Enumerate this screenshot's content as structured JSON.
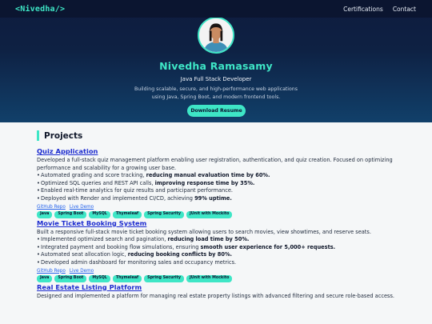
{
  "nav": {
    "brand": "<Nivedha/>",
    "links": [
      "Certifications",
      "Contact"
    ]
  },
  "hero": {
    "name": "Nivedha Ramasamy",
    "role": "Java Full Stack Developer",
    "tagline": "Building scalable, secure, and high-performance web applications using Java, Spring Boot, and modern frontend tools.",
    "button": "Download Resume"
  },
  "projects_section": {
    "title": "Projects"
  },
  "projects": [
    {
      "title": "Quiz Application",
      "description": "Developed a full-stack quiz management platform enabling user registration, authentication, and quiz creation. Focused on optimizing performance and scalability for a growing user base.",
      "bullets": [
        {
          "text": "Automated grading and score tracking, ",
          "bold": "reducing manual evaluation time by 60%."
        },
        {
          "text": "Optimized SQL queries and REST API calls, ",
          "bold": "improving response time by 35%."
        },
        {
          "text": "Enabled real-time analytics for quiz results and participant performance.",
          "bold": ""
        },
        {
          "text": "Deployed with Render and implemented CI/CD, achieving ",
          "bold": "99% uptime."
        }
      ],
      "links": [
        "GitHub Repo",
        "Live Demo"
      ],
      "tags": [
        "Java",
        "Spring Boot",
        "MySQL",
        "Thymeleaf",
        "Spring Security",
        "JUnit with Mockito"
      ]
    },
    {
      "title": "Movie Ticket Booking System",
      "description": "Built a responsive full-stack movie ticket booking system allowing users to search movies, view showtimes, and reserve seats.",
      "bullets": [
        {
          "text": "Implemented optimized search and pagination, ",
          "bold": "reducing load time by 50%."
        },
        {
          "text": "Integrated payment and booking flow simulations, ensuring ",
          "bold": "smooth user experience for 5,000+ requests."
        },
        {
          "text": "Automated seat allocation logic, ",
          "bold": "reducing booking conflicts by 80%."
        },
        {
          "text": "Developed admin dashboard for monitoring sales and occupancy metrics.",
          "bold": ""
        }
      ],
      "links": [
        "GitHub Repo",
        "Live Demo"
      ],
      "tags": [
        "Java",
        "Spring Boot",
        "MySQL",
        "Thymeleaf",
        "Spring Security",
        "JUnit with Mockito"
      ]
    },
    {
      "title": "Real Estate Listing Platform",
      "description": "Designed and implemented a platform for managing real estate property listings with advanced filtering and secure role-based access.",
      "bullets": [],
      "links": [],
      "tags": []
    }
  ],
  "colors": {
    "accent": "#3ee6c6",
    "nav_bg": "#0b1530",
    "link": "#1d2ccf"
  }
}
